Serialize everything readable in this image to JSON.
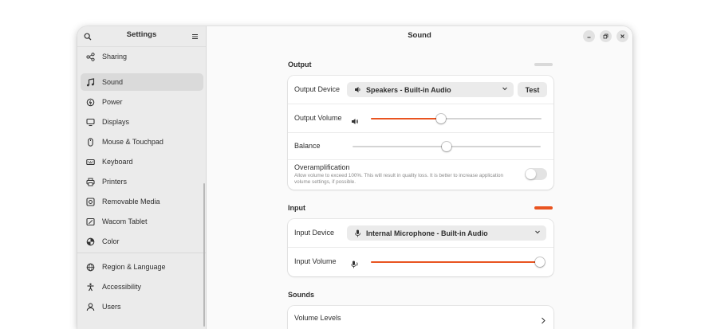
{
  "sidebar": {
    "title": "Settings",
    "items": [
      {
        "label": "Sharing",
        "icon": "share-icon"
      },
      {
        "label": "Sound",
        "icon": "music-note-icon",
        "active": true
      },
      {
        "label": "Power",
        "icon": "power-icon"
      },
      {
        "label": "Displays",
        "icon": "display-icon"
      },
      {
        "label": "Mouse & Touchpad",
        "icon": "mouse-icon"
      },
      {
        "label": "Keyboard",
        "icon": "keyboard-icon"
      },
      {
        "label": "Printers",
        "icon": "printer-icon"
      },
      {
        "label": "Removable Media",
        "icon": "removable-media-icon"
      },
      {
        "label": "Wacom Tablet",
        "icon": "tablet-icon"
      },
      {
        "label": "Color",
        "icon": "color-icon"
      },
      {
        "label": "Region & Language",
        "icon": "globe-icon"
      },
      {
        "label": "Accessibility",
        "icon": "accessibility-icon"
      },
      {
        "label": "Users",
        "icon": "users-icon"
      }
    ]
  },
  "page": {
    "title": "Sound"
  },
  "output": {
    "heading": "Output",
    "level": 0.0,
    "device_label": "Output Device",
    "device_value": "Speakers - Built-in Audio",
    "test_label": "Test",
    "volume_label": "Output Volume",
    "volume_value": 0.41,
    "balance_label": "Balance",
    "balance_value": 0.5,
    "overamp_label": "Overamplification",
    "overamp_desc": "Allow volume to exceed 100%. This will result in quality loss. It is better to increase application volume settings, if possible.",
    "overamp_enabled": false
  },
  "input": {
    "heading": "Input",
    "level": 1.0,
    "device_label": "Input Device",
    "device_value": "Internal Microphone - Built-in Audio",
    "volume_label": "Input Volume",
    "volume_value": 0.99
  },
  "sounds": {
    "heading": "Sounds",
    "volume_levels_label": "Volume Levels"
  },
  "colors": {
    "accent": "#e95420",
    "inactive_level": "#d9d9d9"
  }
}
